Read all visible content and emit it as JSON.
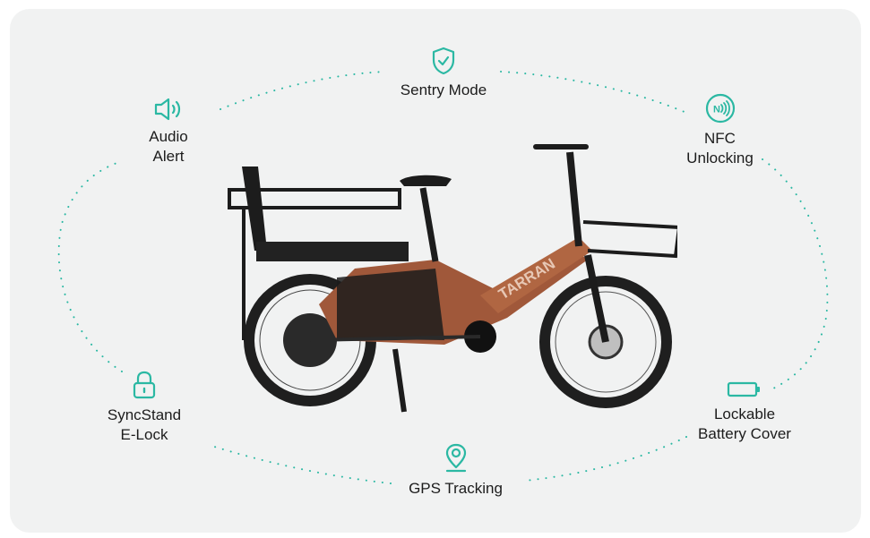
{
  "accent_color": "#2bb8a3",
  "bike": {
    "brand_text": "TARRAN"
  },
  "features": [
    {
      "id": "sentry-mode",
      "icon": "shield-check-icon",
      "lines": [
        "Sentry Mode"
      ]
    },
    {
      "id": "audio-alert",
      "icon": "speaker-icon",
      "lines": [
        "Audio",
        "Alert"
      ]
    },
    {
      "id": "nfc-unlocking",
      "icon": "nfc-icon",
      "lines": [
        "NFC",
        "Unlocking"
      ]
    },
    {
      "id": "syncstand-elock",
      "icon": "padlock-icon",
      "lines": [
        "SyncStand",
        "E-Lock"
      ]
    },
    {
      "id": "gps-tracking",
      "icon": "location-pin-icon",
      "lines": [
        "GPS Tracking"
      ]
    },
    {
      "id": "lockable-battery-cover",
      "icon": "battery-icon",
      "lines": [
        "Lockable",
        "Battery Cover"
      ]
    }
  ]
}
